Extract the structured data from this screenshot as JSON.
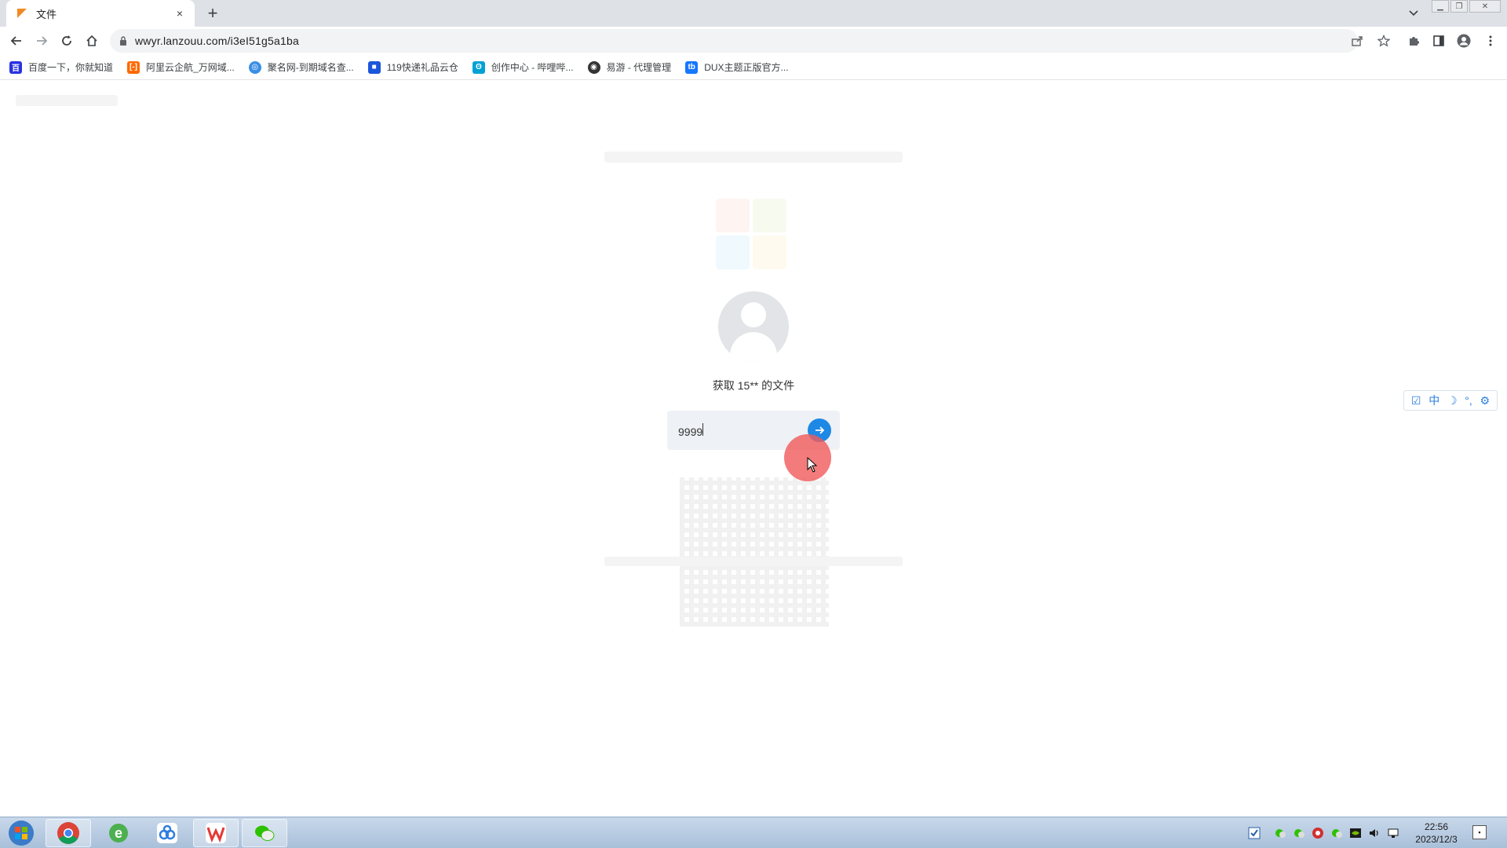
{
  "browser": {
    "tab": {
      "title": "文件",
      "close": "×"
    },
    "new_tab": "+",
    "url": "wwyr.lanzouu.com/i3eI51g5a1ba",
    "bookmarks": [
      {
        "label": "百度一下，你就知道",
        "icon": "baidu-icon",
        "color": "#2932e1"
      },
      {
        "label": "阿里云企航_万网域...",
        "icon": "aliyun-icon",
        "color": "#ff6a00"
      },
      {
        "label": "聚名网-到期域名查...",
        "icon": "globe-icon",
        "color": "#3a8ee6"
      },
      {
        "label": "119快递礼品云仓",
        "icon": "warehouse-icon",
        "color": "#1a56db"
      },
      {
        "label": "创作中心 - 哔哩哔...",
        "icon": "bilibili-icon",
        "color": "#00a1d6"
      },
      {
        "label": "易游 - 代理管理",
        "icon": "game-icon",
        "color": "#333333"
      },
      {
        "label": "DUX主题正版官方...",
        "icon": "dux-icon",
        "color": "#1677ff"
      }
    ]
  },
  "page": {
    "get_file_text": "获取 15** 的文件",
    "password_value": "9999",
    "accent": "#1e88e5"
  },
  "ime": {
    "lang": "中"
  },
  "taskbar": {
    "clock_time": "22:56",
    "clock_date": "2023/12/3"
  }
}
